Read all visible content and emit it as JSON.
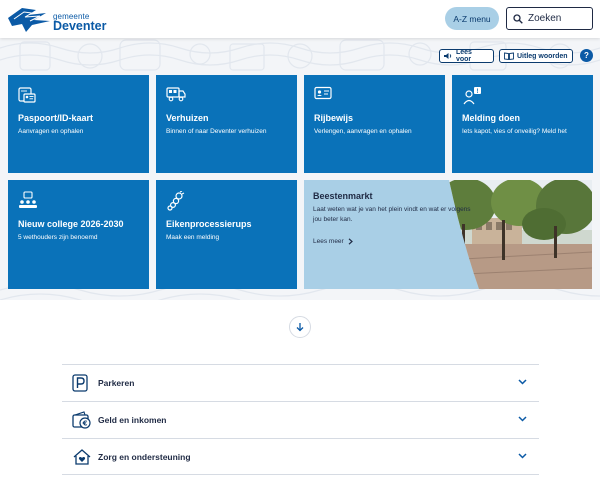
{
  "header": {
    "logo_line1": "gemeente",
    "logo_line2": "Deventer",
    "az_label": "A-Z menu",
    "search_placeholder": "Zoeken"
  },
  "tools": {
    "read_aloud": "Lees voor",
    "explain_words": "Uitleg woorden",
    "help": "?"
  },
  "tiles": [
    {
      "title": "Paspoort/ID-kaart",
      "subtitle": "Aanvragen en ophalen",
      "icon": "id-card-icon"
    },
    {
      "title": "Verhuizen",
      "subtitle": "Binnen of naar Deventer verhuizen",
      "icon": "moving-truck-icon"
    },
    {
      "title": "Rijbewijs",
      "subtitle": "Verlengen, aanvragen en ophalen",
      "icon": "drivers-license-icon"
    },
    {
      "title": "Melding doen",
      "subtitle": "Iets kapot, vies of onveilig? Meld het",
      "icon": "report-person-icon"
    },
    {
      "title": "Nieuw college 2026-2030",
      "subtitle": "5 wethouders zijn benoemd",
      "icon": "council-icon"
    },
    {
      "title": "Eikenprocessierups",
      "subtitle": "Maak een melding",
      "icon": "caterpillar-icon"
    }
  ],
  "feature": {
    "title": "Beestenmarkt",
    "text": "Laat weten wat je van het plein vindt en wat er volgens jou beter kan.",
    "more": "Lees meer"
  },
  "accordion": [
    {
      "label": "Parkeren",
      "icon": "parking-icon"
    },
    {
      "label": "Geld en inkomen",
      "icon": "wallet-euro-icon"
    },
    {
      "label": "Zorg en ondersteuning",
      "icon": "care-home-icon"
    }
  ],
  "colors": {
    "tile_blue": "#0a72b9",
    "brand_blue": "#0b5aa6",
    "light_blue": "#a9cfe6",
    "text_dark": "#1f2a44"
  }
}
